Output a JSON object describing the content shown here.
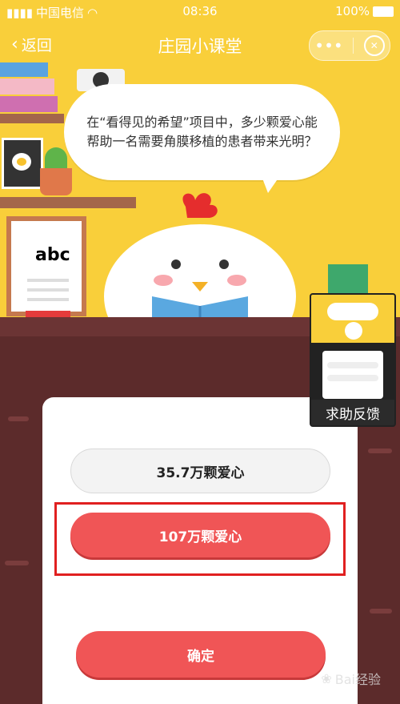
{
  "status_bar": {
    "carrier": "中国电信",
    "time": "08:36",
    "battery": "100%"
  },
  "nav": {
    "back_label": "返回",
    "title": "庄园小课堂",
    "more_icon": "more-dots-icon",
    "close_icon": "close-circle-icon"
  },
  "question": {
    "text": "在“看得见的希望”项目中，多少颗爱心能帮助一名需要角膜移植的患者带来光明？"
  },
  "scene": {
    "board_letters": "abc"
  },
  "options": [
    {
      "label": "35.7万颗爱心",
      "state": "unselected"
    },
    {
      "label": "107万颗爱心",
      "state": "selected"
    }
  ],
  "confirm_label": "确定",
  "help": {
    "label": "求助反馈"
  },
  "watermark": {
    "text": "Bai经验"
  },
  "colors": {
    "scene_bg": "#f9cf3a",
    "accent_red": "#f05556",
    "table_brown": "#5c2b2b",
    "highlight_border": "#e02020"
  }
}
